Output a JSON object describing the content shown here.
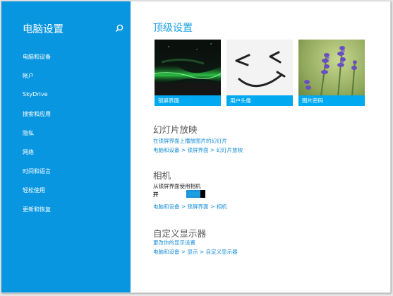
{
  "sidebar": {
    "title": "电脑设置",
    "items": [
      {
        "label": "电脑和设备"
      },
      {
        "label": "帐户"
      },
      {
        "label": "SkyDrive"
      },
      {
        "label": "搜索和应用"
      },
      {
        "label": "隐私"
      },
      {
        "label": "网络"
      },
      {
        "label": "时间和语言"
      },
      {
        "label": "轻松使用"
      },
      {
        "label": "更新和恢复"
      }
    ]
  },
  "main": {
    "top_title": "顶级设置",
    "tiles": [
      {
        "label": "锁屏界面",
        "icon": "aurora-image"
      },
      {
        "label": "用户头像",
        "icon": "smiley-face-image"
      },
      {
        "label": "图片密码",
        "icon": "lavender-image"
      }
    ],
    "slideshow": {
      "title": "幻灯片放映",
      "link": "在锁屏界面上播放图片的幻灯片",
      "breadcrumb": "电脑和设备 > 锁屏界面 > 幻灯片放映"
    },
    "camera": {
      "title": "相机",
      "desc": "从锁屏界面使用相机",
      "toggle_state": "开",
      "toggle_on": true,
      "breadcrumb": "电脑和设备 > 锁屏界面 > 相机"
    },
    "display": {
      "title": "自定义显示器",
      "link": "更改你的显示设置",
      "breadcrumb": "电脑和设备 > 显示 > 自定义显示器"
    }
  },
  "colors": {
    "sidebar_bg": "#0896e0",
    "accent": "#1ba1e2",
    "tile_caption": "#00a9f0"
  }
}
